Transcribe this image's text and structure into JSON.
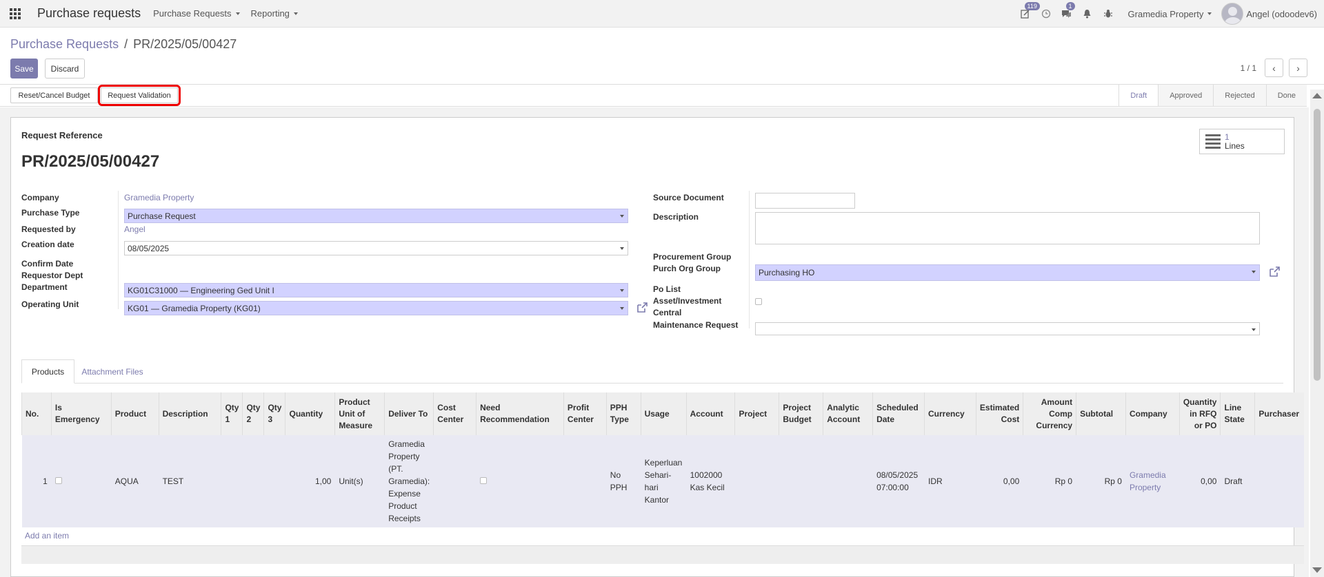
{
  "navbar": {
    "app_title": "Purchase requests",
    "menus": [
      "Purchase Requests",
      "Reporting"
    ],
    "activity_badge": "119",
    "messages_badge": "1",
    "company": "Gramedia Property",
    "user": "Angel (odoodev6)"
  },
  "control_panel": {
    "breadcrumb_parent": "Purchase Requests",
    "breadcrumb_sep": "/",
    "breadcrumb_current": "PR/2025/05/00427",
    "save_label": "Save",
    "discard_label": "Discard",
    "pager_value": "1 / 1"
  },
  "statusbar": {
    "buttons": [
      "Reset/Cancel Budget",
      "Request Validation"
    ],
    "stages": [
      "Draft",
      "Approved",
      "Rejected",
      "Done"
    ],
    "active_stage": "Draft"
  },
  "form": {
    "ref_label": "Request Reference",
    "ref_value": "PR/2025/05/00427",
    "smart_button": {
      "count": "1",
      "label": "Lines"
    },
    "left": {
      "company_label": "Company",
      "company_value": "Gramedia Property",
      "purchase_type_label": "Purchase Type",
      "purchase_type_value": "Purchase Request",
      "requested_by_label": "Requested by",
      "requested_by_value": "Angel",
      "creation_date_label": "Creation date",
      "creation_date_value": "08/05/2025",
      "confirm_date_label": "Confirm Date",
      "requestor_dept_label": "Requestor Dept",
      "department_label": "Department",
      "department_value": "KG01C31000 — Engineering Ged Unit I",
      "operating_unit_label": "Operating Unit",
      "operating_unit_value": "KG01 — Gramedia Property (KG01)"
    },
    "right": {
      "source_document_label": "Source Document",
      "source_document_value": "",
      "description_label": "Description",
      "description_value": "",
      "procurement_group_label": "Procurement Group",
      "purch_org_group_label": "Purch Org Group",
      "purch_org_group_value": "Purchasing HO",
      "po_list_label": "Po List",
      "asset_investment_label": "Asset/Investment",
      "central_label": "Central",
      "maintenance_request_label": "Maintenance Request",
      "central_maintenance_value": ""
    }
  },
  "tabs": [
    "Products",
    "Attachment Files"
  ],
  "table": {
    "headers": [
      "No.",
      "Is Emergency",
      "Product",
      "Description",
      "Qty 1",
      "Qty 2",
      "Qty 3",
      "Quantity",
      "Product Unit of Measure",
      "Deliver To",
      "Cost Center",
      "Need Recommendation",
      "Profit Center",
      "PPH Type",
      "Usage",
      "Account",
      "Project",
      "Project Budget",
      "Analytic Account",
      "Scheduled Date",
      "Currency",
      "Estimated Cost",
      "Amount Comp Currency",
      "Subtotal",
      "Company",
      "Quantity in RFQ or PO",
      "Line State",
      "Purchaser"
    ],
    "rows": [
      {
        "no": "1",
        "is_emergency": false,
        "product": "AQUA",
        "description": "TEST",
        "qty1": "",
        "qty2": "",
        "qty3": "",
        "quantity": "1,00",
        "uom": "Unit(s)",
        "deliver_to": "Gramedia Property (PT. Gramedia): Expense Product Receipts",
        "cost_center": "",
        "need_recommendation": false,
        "profit_center": "",
        "pph_type": "No PPH",
        "usage": "Keperluan Sehari-hari Kantor",
        "account": "1002000 Kas Kecil",
        "project": "",
        "project_budget": "",
        "analytic_account": "",
        "scheduled_date": "08/05/2025 07:00:00",
        "currency": "IDR",
        "estimated_cost": "0,00",
        "amount_comp_currency": "Rp 0",
        "subtotal": "Rp 0",
        "company": "Gramedia Property",
        "qty_rfq_po": "0,00",
        "line_state": "Draft",
        "purchaser": ""
      }
    ],
    "add_item_label": "Add an item"
  },
  "colors": {
    "accent": "#7c7bad",
    "highlight_border": "#e00000",
    "select_bg": "#d2d2ff"
  },
  "icons": [
    "apps-icon",
    "activity-icon",
    "clock-icon",
    "chat-icon",
    "bell-icon",
    "bug-icon",
    "list-icon",
    "external-link-icon",
    "chevron-left-icon",
    "chevron-right-icon"
  ]
}
